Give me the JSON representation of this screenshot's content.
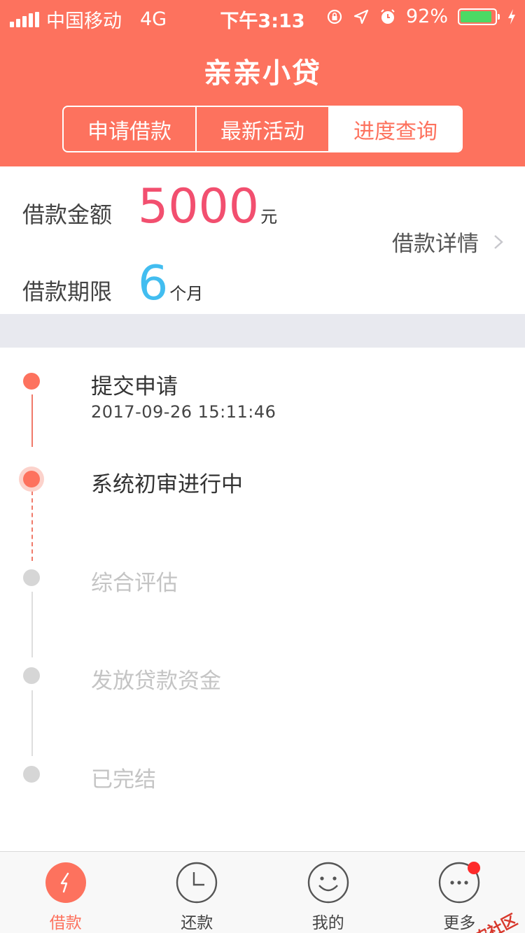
{
  "status_bar": {
    "carrier": "中国移动",
    "network": "4G",
    "time": "下午3:13",
    "battery_text": "92%",
    "battery_level": 0.92
  },
  "header": {
    "title": "亲亲小贷",
    "tabs": [
      {
        "label": "申请借款"
      },
      {
        "label": "最新活动"
      },
      {
        "label": "进度查询"
      }
    ],
    "active_tab_index": 2
  },
  "loan": {
    "amount_label": "借款金额",
    "amount_value": "5000",
    "amount_unit": "元",
    "term_label": "借款期限",
    "term_value": "6",
    "term_unit": "个月",
    "detail_link": "借款详情"
  },
  "progress": {
    "steps": [
      {
        "title": "提交申请",
        "time": "2017-09-26 15:11:46",
        "state": "done"
      },
      {
        "title": "系统初审进行中",
        "state": "current"
      },
      {
        "title": "综合评估",
        "state": "pending"
      },
      {
        "title": "发放贷款资金",
        "state": "pending"
      },
      {
        "title": "已完结",
        "state": "pending"
      }
    ]
  },
  "tabbar": {
    "items": [
      {
        "label": "借款",
        "icon": "lightning-icon"
      },
      {
        "label": "还款",
        "icon": "clock-icon"
      },
      {
        "label": "我的",
        "icon": "smiley-icon"
      },
      {
        "label": "更多",
        "icon": "more-dots-icon"
      }
    ],
    "active_index": 0
  },
  "watermark": "卡农社区",
  "colors": {
    "brand": "#fd725e",
    "amount": "#f24f6f",
    "term": "#42bdf0",
    "pending": "#d6d6d6"
  }
}
